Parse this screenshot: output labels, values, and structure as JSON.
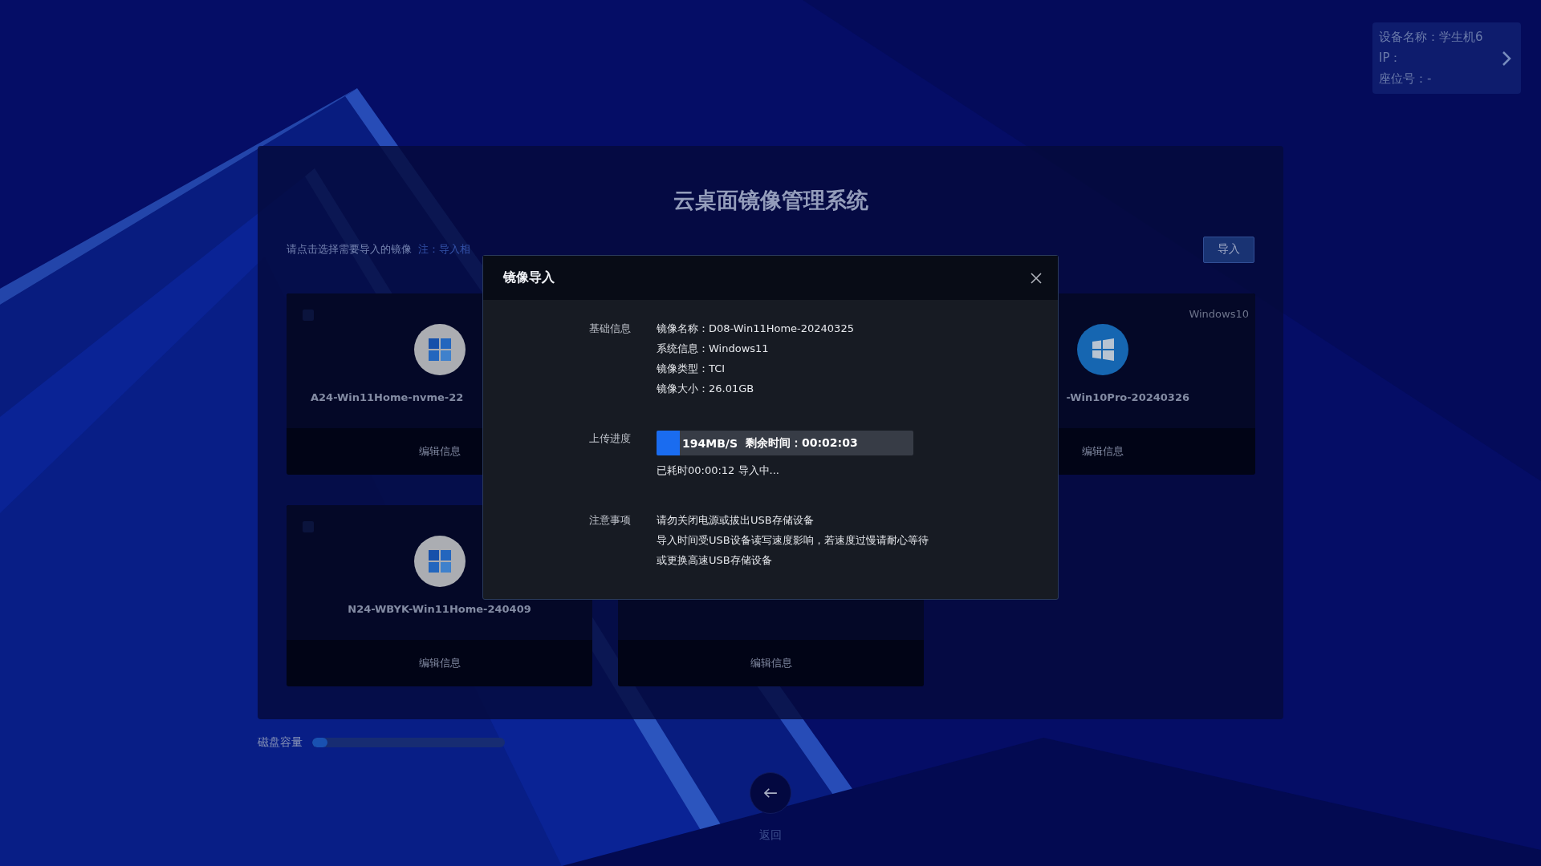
{
  "device_info": {
    "name": "设备名称：学生机6",
    "ip": "IP：",
    "seat": "座位号：-"
  },
  "title": "云桌面镜像管理系统",
  "hint": "请点击选择需要导入的镜像",
  "note": "注：导入相",
  "import_button": "导入",
  "cards": [
    {
      "kind": "win11",
      "name": "A24-Win11Home-nvme-22",
      "footer": "编辑信息",
      "checked": false
    },
    {
      "kind": "win10",
      "tag": "Windows10",
      "name": "-Win10Pro-20240326",
      "footer": "编辑信息"
    },
    {
      "kind": "win11",
      "name": "N24-WBYK-Win11Home-240409",
      "footer": "编辑信息",
      "checked": false
    },
    {
      "footer": "编辑信息"
    }
  ],
  "disk": {
    "label": "磁盘容量",
    "level": 0.08
  },
  "back": {
    "label": "返回"
  },
  "dialog": {
    "title": "镜像导入",
    "sections": [
      {
        "label": "基础信息",
        "lines": [
          "镜像名称：D08-Win11Home-20240325",
          "系统信息：Windows11",
          "镜像类型：TCI",
          "镜像大小：26.01GB"
        ]
      },
      {
        "label": "上传进度",
        "progress": {
          "level": 0.09,
          "speed": "194MB/S",
          "remaining": "剩余时间：00:02:03"
        },
        "lines": [
          "已耗时00:00:12 导入中..."
        ]
      },
      {
        "label": "注意事项",
        "lines": [
          "请勿关闭电源或拔出USB存储设备",
          "导入时间受USB设备读写速度影响，若速度过慢请耐心等待",
          "或更换高速USB存储设备"
        ]
      }
    ]
  }
}
